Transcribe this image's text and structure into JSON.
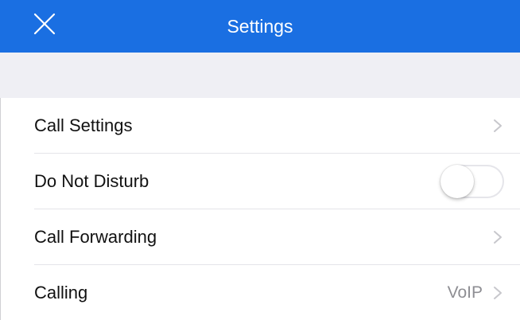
{
  "nav": {
    "title": "Settings",
    "close_icon": "close-icon",
    "background_color": "#1a6fe2"
  },
  "settings": {
    "rows": [
      {
        "label": "Call Settings",
        "accessory": "chevron-right-icon"
      },
      {
        "label": "Do Not Disturb",
        "accessory": "toggle",
        "toggle_on": false
      },
      {
        "label": "Call Forwarding",
        "accessory": "chevron-right-icon"
      },
      {
        "label": "Calling",
        "value": "VoIP",
        "accessory": "chevron-right-icon"
      }
    ]
  }
}
